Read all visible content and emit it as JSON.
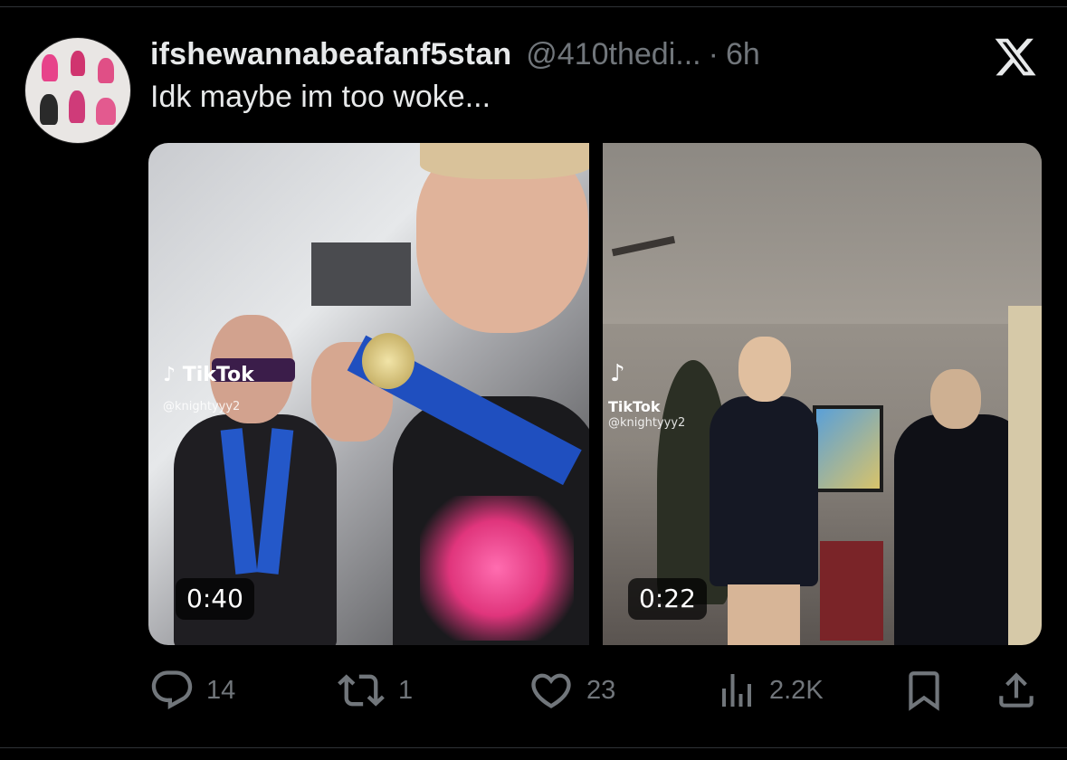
{
  "tweet": {
    "display_name": "ifshewannabeafanf5stan",
    "handle": "@410thedi...",
    "separator": "·",
    "time": "6h",
    "text": "Idk maybe im too woke..."
  },
  "media": [
    {
      "tiktok_label": "TikTok",
      "tiktok_handle": "@knightyyy2",
      "duration": "0:40"
    },
    {
      "tiktok_label": "TikTok",
      "tiktok_handle": "@knightyyy2",
      "duration": "0:22"
    }
  ],
  "actions": {
    "reply_count": "14",
    "repost_count": "1",
    "like_count": "23",
    "views_count": "2.2K"
  },
  "icons": {
    "platform": "x-logo-icon",
    "reply": "reply-icon",
    "repost": "repost-icon",
    "like": "heart-icon",
    "views": "views-icon",
    "bookmark": "bookmark-icon",
    "share": "share-icon"
  },
  "colors": {
    "background": "#000000",
    "text_primary": "#e7e9ea",
    "text_secondary": "#71767b"
  }
}
